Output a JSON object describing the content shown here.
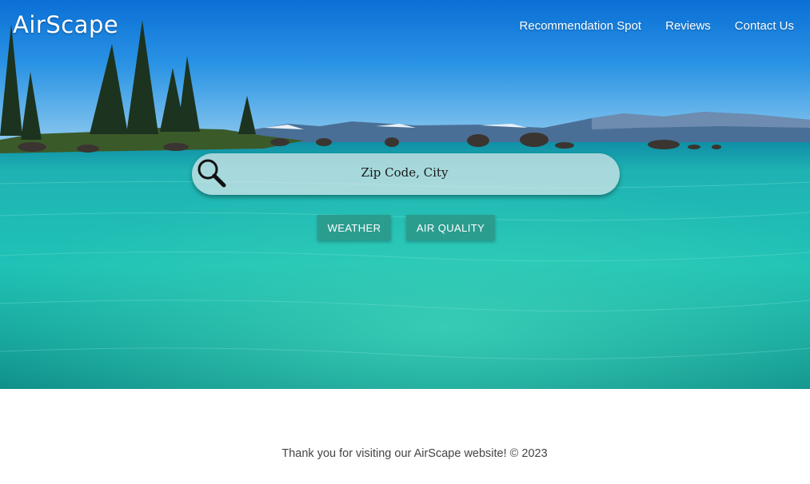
{
  "header": {
    "brand": "AirScape",
    "nav": [
      {
        "label": "Recommendation Spot"
      },
      {
        "label": "Reviews"
      },
      {
        "label": "Contact Us"
      }
    ]
  },
  "search": {
    "placeholder": "Zip Code, City",
    "value": ""
  },
  "actions": {
    "weather_label": "WEATHER",
    "air_quality_label": "AIR QUALITY"
  },
  "footer": {
    "text": "Thank you for visiting our AirScape website! © 2023"
  },
  "colors": {
    "button": "#2a9d8f",
    "sky_top": "#0b6fd4",
    "water": "#1fbfb4"
  },
  "hero": {
    "image": "lake-with-pine-trees-and-mountains"
  }
}
